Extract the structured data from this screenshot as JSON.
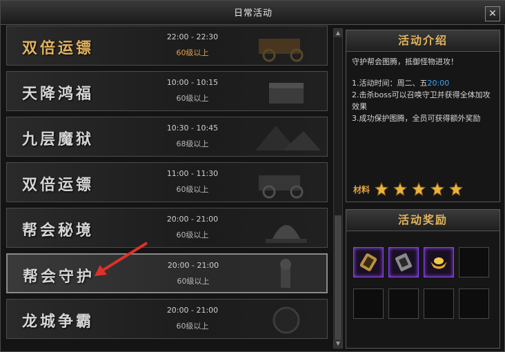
{
  "window": {
    "title": "日常活动",
    "close_label": "✕"
  },
  "activities": [
    {
      "name": "双倍运镖",
      "time": "22:00 - 22:30",
      "level": "60级以上",
      "highlight": true
    },
    {
      "name": "天降鸿福",
      "time": "10:00 - 10:15",
      "level": "60级以上",
      "highlight": false
    },
    {
      "name": "九层魔狱",
      "time": "10:30 - 10:45",
      "level": "68级以上",
      "highlight": false
    },
    {
      "name": "双倍运镖",
      "time": "11:00 - 11:30",
      "level": "60级以上",
      "highlight": false
    },
    {
      "name": "帮会秘境",
      "time": "20:00 - 21:00",
      "level": "60级以上",
      "highlight": false
    },
    {
      "name": "帮会守护",
      "time": "20:00 - 21:00",
      "level": "60级以上",
      "highlight": false
    },
    {
      "name": "龙城争霸",
      "time": "20:00 - 21:00",
      "level": "60级以上",
      "highlight": false
    }
  ],
  "intro": {
    "title": "活动介绍",
    "summary": "守护帮会图腾，抵御怪物进攻！",
    "line1_prefix": "1.活动时间：周二、五",
    "line1_time": "20:00",
    "line2": "2.击杀boss可以召唤守卫并获得全体加攻效果",
    "line3": "3.成功保护图腾，全员可获得额外奖励",
    "rating_label": "材料",
    "rating_stars": 5
  },
  "rewards": {
    "title": "活动奖励",
    "items": [
      "token-icon",
      "tag-icon",
      "gold-ingot-icon",
      "",
      "",
      "",
      "",
      ""
    ]
  },
  "colors": {
    "gold": "#e2b35c",
    "accent_blue": "#3aa8ff",
    "purple_glow": "#9a4cff",
    "arrow_red": "#e0302a"
  }
}
